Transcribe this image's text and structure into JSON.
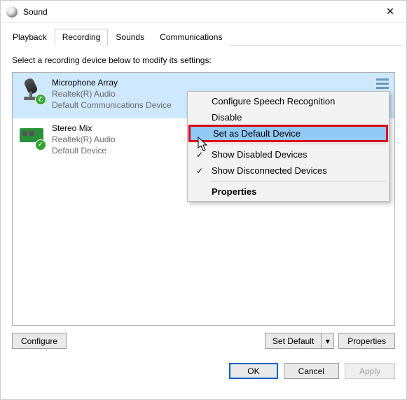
{
  "window": {
    "title": "Sound"
  },
  "tabs": [
    {
      "label": "Playback"
    },
    {
      "label": "Recording"
    },
    {
      "label": "Sounds"
    },
    {
      "label": "Communications"
    }
  ],
  "instructions": "Select a recording device below to modify its settings:",
  "devices": [
    {
      "name": "Microphone Array",
      "line2": "Realtek(R) Audio",
      "line3": "Default Communications Device"
    },
    {
      "name": "Stereo Mix",
      "line2": "Realtek(R) Audio",
      "line3": "Default Device"
    }
  ],
  "buttons": {
    "configure": "Configure",
    "set_default": "Set Default",
    "properties": "Properties",
    "ok": "OK",
    "cancel": "Cancel",
    "apply": "Apply"
  },
  "context_menu": {
    "configure_sr": "Configure Speech Recognition",
    "disable": "Disable",
    "set_default_device": "Set as Default Device",
    "show_disabled": "Show Disabled Devices",
    "show_disconnected": "Show Disconnected Devices",
    "properties": "Properties"
  },
  "glyphs": {
    "check": "✓",
    "close": "✕",
    "phone": "✆",
    "down": "▾"
  }
}
